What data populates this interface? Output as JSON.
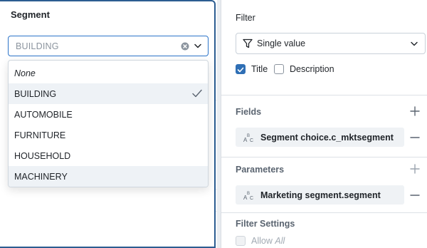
{
  "widget": {
    "title": "Segment",
    "select_value": "BUILDING",
    "options": [
      {
        "label": "None",
        "italic": true
      },
      {
        "label": "BUILDING",
        "selected": true
      },
      {
        "label": "AUTOMOBILE"
      },
      {
        "label": "FURNITURE"
      },
      {
        "label": "HOUSEHOLD"
      },
      {
        "label": "MACHINERY",
        "hover": true
      }
    ]
  },
  "panel": {
    "filter_label": "Filter",
    "filter_type": "Single value",
    "title_checkbox": {
      "label": "Title",
      "checked": true
    },
    "description_checkbox": {
      "label": "Description",
      "checked": false
    },
    "fields_label": "Fields",
    "field_chip": "Segment choice.c_mktsegment",
    "parameters_label": "Parameters",
    "parameter_chip": "Marketing segment.segment",
    "filter_settings_label": "Filter Settings",
    "allow_prefix": "Allow",
    "allow_all": "All"
  },
  "colors": {
    "accent": "#2f6fb5",
    "widget_border": "#2c5d91",
    "select_border": "#2c74c9"
  }
}
